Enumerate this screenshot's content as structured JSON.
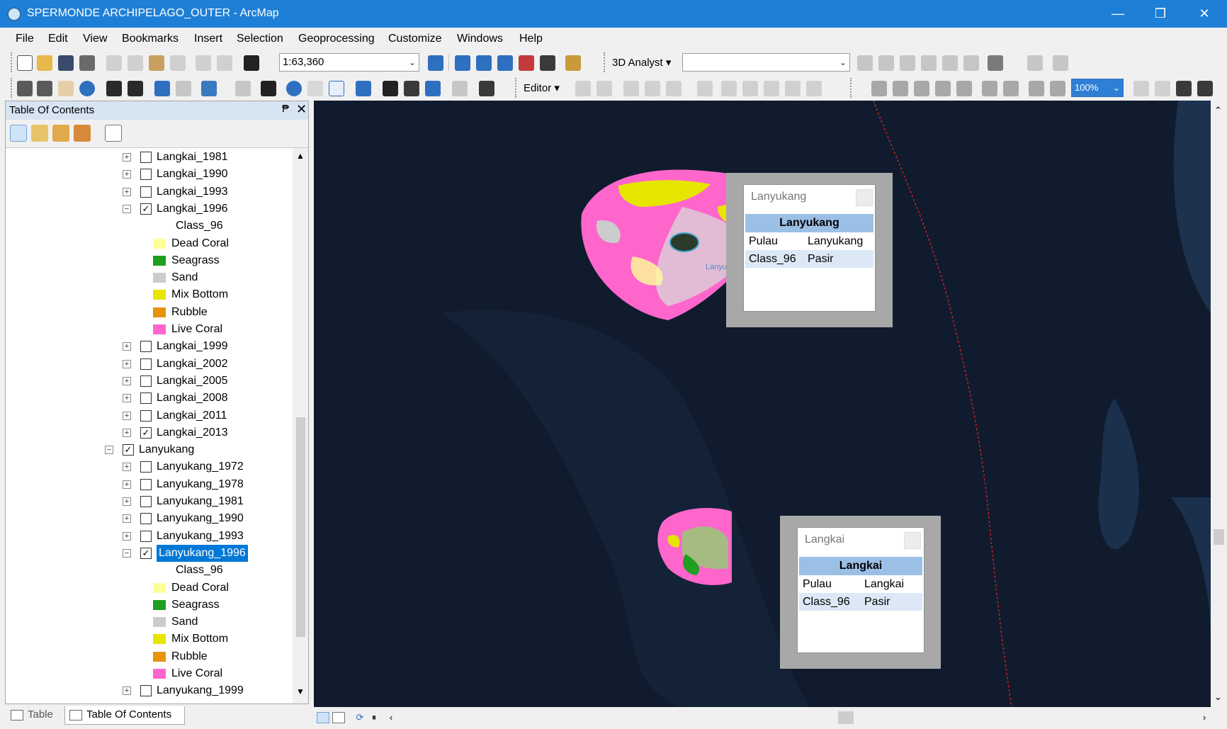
{
  "window": {
    "title": "SPERMONDE ARCHIPELAGO_OUTER - ArcMap",
    "minimize": "—",
    "restore": "❐",
    "close": "✕"
  },
  "menu": [
    "File",
    "Edit",
    "View",
    "Bookmarks",
    "Insert",
    "Selection",
    "Geoprocessing",
    "Customize",
    "Windows",
    "Help"
  ],
  "toolbar": {
    "scale": "1:63,360",
    "analyst_label": "3D Analyst ▾",
    "analyst_layer": "",
    "editor_label": "Editor ▾",
    "zoom_value": "100%"
  },
  "toc": {
    "title": "Table Of Contents",
    "pin": "₱",
    "close": "✕",
    "rows": [
      {
        "label": "Langkai_1981",
        "checked": false,
        "expand": "+"
      },
      {
        "label": "Langkai_1990",
        "checked": false,
        "expand": "+"
      },
      {
        "label": "Langkai_1993",
        "checked": false,
        "expand": "+"
      },
      {
        "label": "Langkai_1996",
        "checked": true,
        "expand": "−"
      },
      {
        "label": "Class_96",
        "type": "field"
      },
      {
        "label": "Dead Coral",
        "type": "legend",
        "color": "#ffff99"
      },
      {
        "label": "Seagrass",
        "type": "legend",
        "color": "#1f9e1f"
      },
      {
        "label": "Sand",
        "type": "legend",
        "color": "#cccccc"
      },
      {
        "label": "Mix Bottom",
        "type": "legend",
        "color": "#e6e600"
      },
      {
        "label": "Rubble",
        "type": "legend",
        "color": "#e8930c"
      },
      {
        "label": "Live Coral",
        "type": "legend",
        "color": "#ff66cc"
      },
      {
        "label": "Langkai_1999",
        "checked": false,
        "expand": "+"
      },
      {
        "label": "Langkai_2002",
        "checked": false,
        "expand": "+"
      },
      {
        "label": "Langkai_2005",
        "checked": false,
        "expand": "+"
      },
      {
        "label": "Langkai_2008",
        "checked": false,
        "expand": "+"
      },
      {
        "label": "Langkai_2011",
        "checked": false,
        "expand": "+"
      },
      {
        "label": "Langkai_2013",
        "checked": true,
        "expand": "+"
      },
      {
        "label": "Lanyukang",
        "checked": true,
        "expand": "−",
        "type": "group"
      },
      {
        "label": "Lanyukang_1972",
        "checked": false,
        "expand": "+"
      },
      {
        "label": "Lanyukang_1978",
        "checked": false,
        "expand": "+"
      },
      {
        "label": "Lanyukang_1981",
        "checked": false,
        "expand": "+"
      },
      {
        "label": "Lanyukang_1990",
        "checked": false,
        "expand": "+"
      },
      {
        "label": "Lanyukang_1993",
        "checked": false,
        "expand": "+"
      },
      {
        "label": "Lanyukang_1996",
        "checked": true,
        "expand": "−",
        "selected": true
      },
      {
        "label": "Class_96",
        "type": "field"
      },
      {
        "label": "Dead Coral",
        "type": "legend",
        "color": "#ffff99"
      },
      {
        "label": "Seagrass",
        "type": "legend",
        "color": "#1f9e1f"
      },
      {
        "label": "Sand",
        "type": "legend",
        "color": "#cccccc"
      },
      {
        "label": "Mix Bottom",
        "type": "legend",
        "color": "#e6e600"
      },
      {
        "label": "Rubble",
        "type": "legend",
        "color": "#e8930c"
      },
      {
        "label": "Live Coral",
        "type": "legend",
        "color": "#ff66cc"
      },
      {
        "label": "Lanyukang_1999",
        "checked": false,
        "expand": "+"
      }
    ],
    "tabs": [
      "Table",
      "Table Of Contents"
    ]
  },
  "popups": [
    {
      "title": "Lanyukang",
      "header": "Lanyukang",
      "rows": [
        {
          "key": "Pulau",
          "value": "Lanyukang"
        },
        {
          "key": "Class_96",
          "value": "Pasir"
        }
      ]
    },
    {
      "title": "Langkai",
      "header": "Langkai",
      "rows": [
        {
          "key": "Pulau",
          "value": "Langkai"
        },
        {
          "key": "Class_96",
          "value": "Pasir"
        }
      ]
    }
  ],
  "map": {
    "label_lanyukang": "Lanyukang",
    "colors": {
      "water": "#0f1a2b",
      "live_coral": "#ff66cc",
      "dead_coral": "#ffff99",
      "mix_bottom": "#e6e600",
      "sand": "#cccccc",
      "seagrass": "#1f9e1f",
      "boundary": "#d22020"
    }
  }
}
